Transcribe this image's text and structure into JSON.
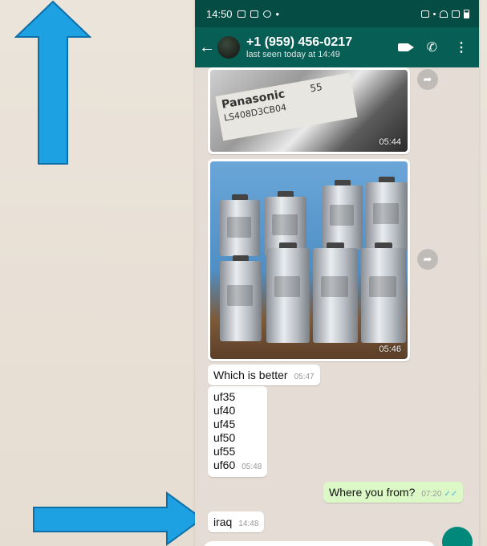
{
  "status_bar": {
    "time": "14:50",
    "dot": "•"
  },
  "header": {
    "back": "←",
    "contact_name": "+1 (959) 456-0217",
    "last_seen": "last seen today at 14:49",
    "avatar_icon": "profile-avatar",
    "video_icon": "video-call-icon",
    "call_icon": "phone-icon",
    "menu_icon": "more-vert-icon"
  },
  "messages": {
    "image1": {
      "brand": "Panasonic",
      "model": "LS408D3CB04",
      "label_number": "55",
      "time": "05:44"
    },
    "image2": {
      "time": "05:46"
    },
    "which_better": {
      "text": "Which is better",
      "time": "05:47"
    },
    "list": {
      "lines": [
        "uf35",
        "uf40",
        "uf45",
        "uf50",
        "uf55",
        "uf60"
      ],
      "time": "05:48"
    },
    "where_from": {
      "text": "Where you from?",
      "time": "07:20",
      "ticks": "✓✓"
    },
    "iraq": {
      "text": "iraq",
      "time": "14:48"
    }
  },
  "colors": {
    "header": "#075e54",
    "status_bar": "#054d44",
    "outgoing_bubble": "#dcf8c6",
    "arrow": "#1da1e2"
  }
}
